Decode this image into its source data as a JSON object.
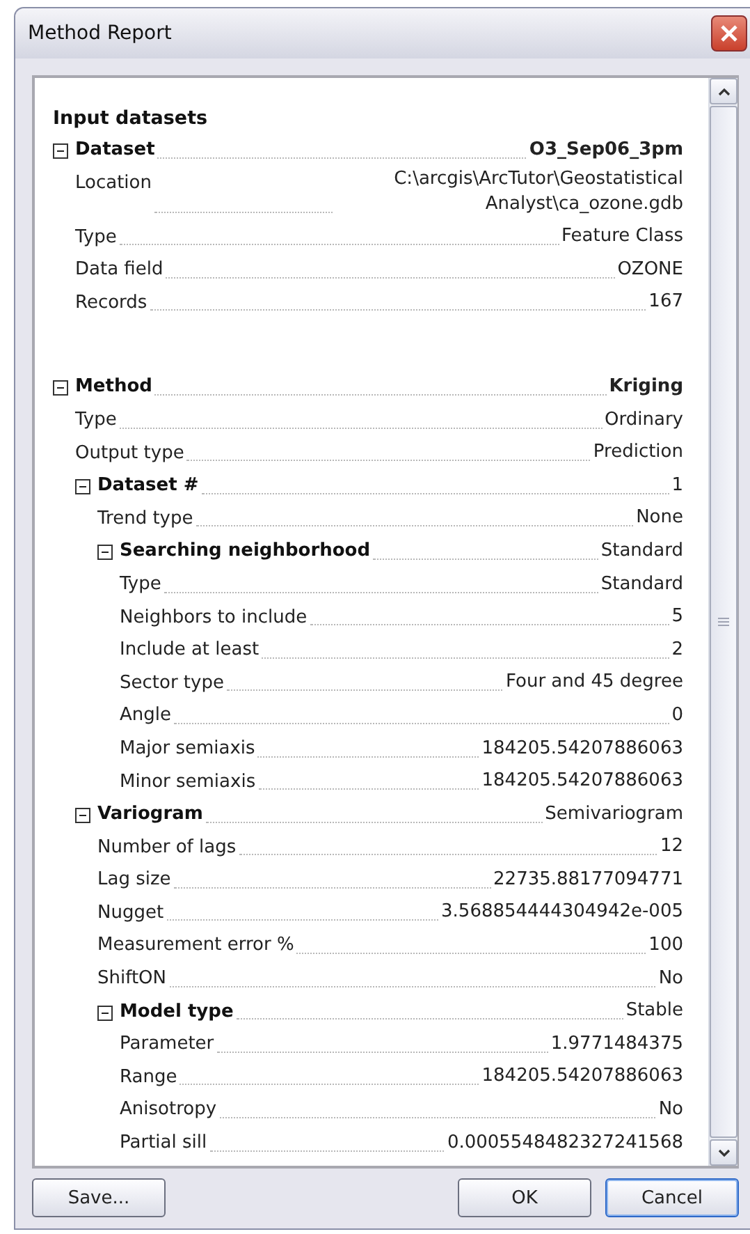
{
  "window": {
    "title": "Method Report"
  },
  "report": {
    "heading": "Input datasets",
    "sections": [
      {
        "label": "Dataset",
        "value": "O3_Sep06_3pm",
        "expanded": true,
        "children": [
          {
            "label": "Location",
            "value": "C:\\arcgis\\ArcTutor\\Geostatistical Analyst\\ca_ozone.gdb"
          },
          {
            "label": "Type",
            "value": "Feature Class"
          },
          {
            "label": "Data field",
            "value": "OZONE"
          },
          {
            "label": "Records",
            "value": "167"
          }
        ]
      },
      {
        "label": "Method",
        "value": "Kriging",
        "expanded": true,
        "children": [
          {
            "label": "Type",
            "value": "Ordinary"
          },
          {
            "label": "Output type",
            "value": "Prediction"
          },
          {
            "label": "Dataset #",
            "value": "1",
            "expanded": true,
            "children": [
              {
                "label": "Trend type",
                "value": "None"
              },
              {
                "label": "Searching neighborhood",
                "value": "Standard",
                "expanded": true,
                "children": [
                  {
                    "label": "Type",
                    "value": "Standard"
                  },
                  {
                    "label": "Neighbors to include",
                    "value": "5"
                  },
                  {
                    "label": "Include at least",
                    "value": "2"
                  },
                  {
                    "label": "Sector type",
                    "value": "Four and 45 degree"
                  },
                  {
                    "label": "Angle",
                    "value": "0"
                  },
                  {
                    "label": "Major semiaxis",
                    "value": "184205.54207886063"
                  },
                  {
                    "label": "Minor semiaxis",
                    "value": "184205.54207886063"
                  }
                ]
              }
            ]
          },
          {
            "label": "Variogram",
            "value": "Semivariogram",
            "expanded": true,
            "children": [
              {
                "label": "Number of lags",
                "value": "12"
              },
              {
                "label": "Lag size",
                "value": "22735.88177094771"
              },
              {
                "label": "Nugget",
                "value": "3.568854444304942e-005"
              },
              {
                "label": "Measurement error %",
                "value": "100"
              },
              {
                "label": "ShiftON",
                "value": "No"
              },
              {
                "label": "Model type",
                "value": "Stable",
                "expanded": true,
                "children": [
                  {
                    "label": "Parameter",
                    "value": "1.9771484375"
                  },
                  {
                    "label": "Range",
                    "value": "184205.54207886063"
                  },
                  {
                    "label": "Anisotropy",
                    "value": "No"
                  },
                  {
                    "label": "Partial sill",
                    "value": "0.0005548482327241568"
                  }
                ]
              }
            ]
          }
        ]
      }
    ]
  },
  "buttons": [
    {
      "label": "Save...",
      "default": false
    },
    {
      "label": "OK",
      "default": false
    },
    {
      "label": "Cancel",
      "default": true
    }
  ]
}
